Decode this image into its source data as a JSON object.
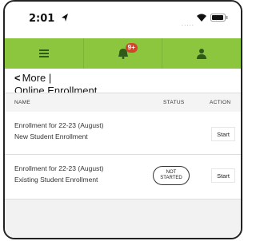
{
  "status_bar": {
    "time": "2:01",
    "signal": "....."
  },
  "navbar": {
    "items": [
      {
        "icon": "menu-icon"
      },
      {
        "icon": "bell-icon",
        "badge": "9+"
      },
      {
        "icon": "user-icon"
      }
    ],
    "color": "#8cc63f",
    "badge_color": "#d2452b"
  },
  "header": {
    "back_chevron": "<",
    "back_label": "More |",
    "title": "Online Enrollment"
  },
  "table": {
    "columns": [
      "NAME",
      "STATUS",
      "ACTION"
    ],
    "rows": [
      {
        "line1": "Enrollment for 22-23 (August)",
        "line2": "New Student Enrollment",
        "status_line1": "",
        "status_line2": "",
        "action": "Start"
      },
      {
        "line1": "Enrollment for 22-23 (August)",
        "line2": "Existing Student Enrollment",
        "status_line1": "NOT",
        "status_line2": "STARTED",
        "action": "Start"
      }
    ]
  }
}
